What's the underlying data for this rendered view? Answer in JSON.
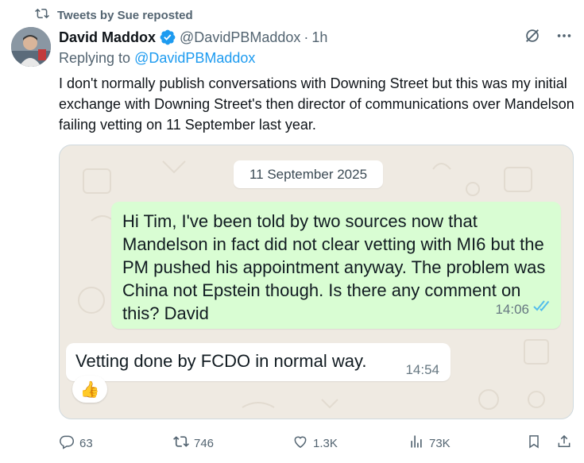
{
  "repost": {
    "label": "Tweets by Sue reposted"
  },
  "author": {
    "name": "David Maddox",
    "handle": "@DavidPBMaddox",
    "separator": "·",
    "time": "1h"
  },
  "reply": {
    "prefix": "Replying to ",
    "mention": "@DavidPBMaddox"
  },
  "tweet": {
    "text": "I don't normally publish conversations with Downing Street but this was my initial exchange with Downing Street's then director of communications over Mandelson failing vetting on 11 September last year."
  },
  "media": {
    "date_chip": "11 September 2025",
    "outgoing": {
      "text": "Hi Tim, I've been told by two sources now that Mandelson in fact did not clear vetting with MI6 but the PM pushed his appointment anyway. The problem was China not Epstein though. Is there any comment on this? David",
      "time": "14:06"
    },
    "incoming": {
      "text": "Vetting done by FCDO in normal way.",
      "time": "14:54"
    },
    "reaction": "👍"
  },
  "actions": {
    "replies": "63",
    "reposts": "746",
    "likes": "1.3K",
    "views": "73K"
  },
  "colors": {
    "accent": "#1d9bf0",
    "muted": "#536471",
    "outgoing_bubble": "#d9fdd3",
    "chat_bg": "#efeae2"
  }
}
